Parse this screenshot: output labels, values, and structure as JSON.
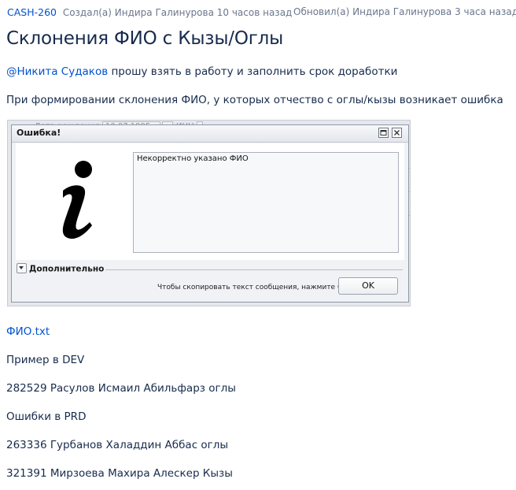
{
  "issue": {
    "key": "CASH-260",
    "created": "Создал(а) Индира Галинурова 10 часов назад",
    "updated": "Обновил(а) Индира Галинурова 3 часа назад",
    "title": "Склонения ФИО с Кызы/Оглы"
  },
  "body": {
    "mention": "@Никита Судаков",
    "mention_text": " прошу взять в работу и заполнить срок доработки",
    "paragraph": "При формировании склонения ФИО, у которых отчество с оглы/кызы возникает ошибка",
    "attachment": "ФИО.txt",
    "lines": [
      "Пример в DEV",
      "282529 Расулов Исмаил Абильфарз оглы",
      "Ошибки в PRD",
      "263336 Гурбанов Халаддин Аббас оглы",
      "321391 Мирзоева Махира Алескер Кызы"
    ]
  },
  "screenshot": {
    "background": {
      "birth_label": "Дата рождения",
      "birth_value": "10.07.1995",
      "inn_label": "ИНН"
    },
    "dialog": {
      "title": "Ошибка!",
      "message": "Некорректно указано ФИО",
      "more_label": "Дополнительно",
      "copy_hint": "Чтобы скопировать текст сообщения, нажмите Ctrl+C",
      "ok_label": "OK",
      "icon": "info-icon"
    }
  },
  "colors": {
    "link": "#0052cc",
    "text": "#172b4d",
    "meta": "#6b778c"
  }
}
